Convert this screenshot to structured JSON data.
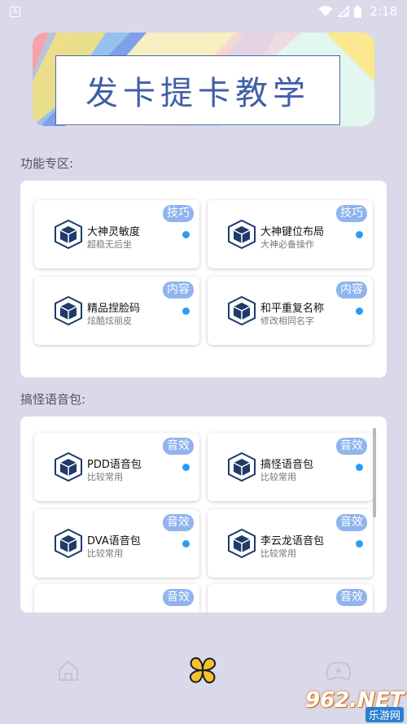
{
  "status_bar": {
    "app_icon_letter": "A",
    "time": "2:18"
  },
  "banner": {
    "title": "发卡提卡教学"
  },
  "sections": {
    "features_label": "功能专区:",
    "voice_label": "搞怪语音包:"
  },
  "features": [
    {
      "title": "大神灵敏度",
      "subtitle": "超稳无后坐",
      "badge": "技巧"
    },
    {
      "title": "大神键位布局",
      "subtitle": "大神必备操作",
      "badge": "技巧"
    },
    {
      "title": "精品捏脸码",
      "subtitle": "炫酷炫丽皮",
      "badge": "内容"
    },
    {
      "title": "和平重复名称",
      "subtitle": "修改相同名字",
      "badge": "内容"
    }
  ],
  "voice_packs": [
    {
      "title": "PDD语音包",
      "subtitle": "比较常用",
      "badge": "音效"
    },
    {
      "title": "搞怪语音包",
      "subtitle": "比较常用",
      "badge": "音效"
    },
    {
      "title": "DVA语音包",
      "subtitle": "比较常用",
      "badge": "音效"
    },
    {
      "title": "李云龙语音包",
      "subtitle": "比较常用",
      "badge": "音效"
    },
    {
      "title": "",
      "subtitle": "",
      "badge": "音效"
    },
    {
      "title": "",
      "subtitle": "",
      "badge": "音效"
    }
  ],
  "bottom_nav": {
    "items": [
      "home-icon",
      "clover-icon",
      "gamepad-icon"
    ]
  },
  "watermark": {
    "main": "962.NET",
    "sub": "乐游网"
  },
  "colors": {
    "background": "#d9d9ea",
    "badge": "#8fb4ee",
    "dot": "#2d9cf0",
    "active_nav": "#f4c430"
  }
}
